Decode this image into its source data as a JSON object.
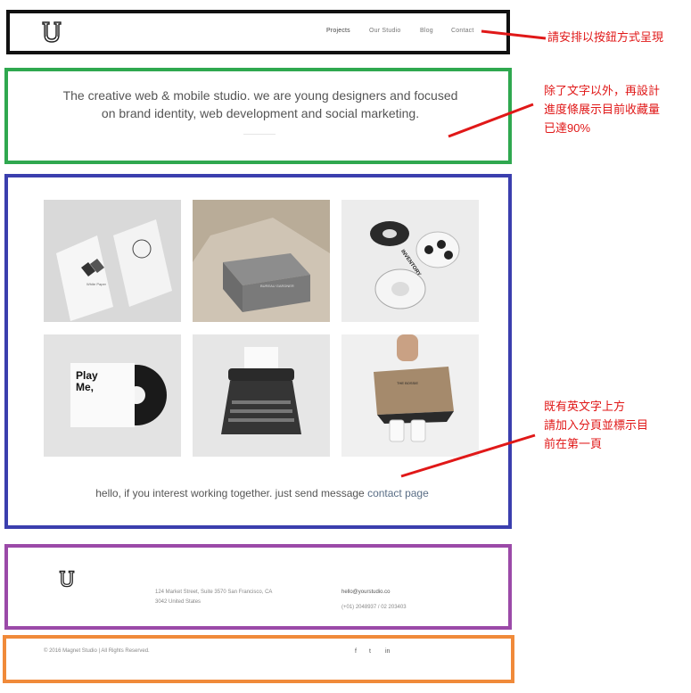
{
  "header": {
    "logo_letter": "U",
    "nav": [
      "Projects",
      "Our Studio",
      "Blog",
      "Contact"
    ]
  },
  "hero": {
    "line1": "The creative web & mobile studio. we are young designers and focused",
    "line2": "on brand identity, web development and social marketing."
  },
  "gallery": {
    "tiles": [
      {
        "label": "White Paper"
      },
      {
        "label": "BUREAU GARDNER"
      },
      {
        "label": "INVENTORY"
      },
      {
        "label": "Play Me,"
      },
      {
        "label": ""
      },
      {
        "label": "THE BOSSIE"
      }
    ],
    "caption_text": "hello, if you interest working together. just send message",
    "caption_link": "contact page"
  },
  "footer": {
    "address_line1": "124 Market Street, Suite 3570 San Francisco, CA",
    "address_line2": "3042 United States",
    "email": "hello@yourstudio.co",
    "phone": "(+01) 2048937 / 02 203403"
  },
  "bottom": {
    "copyright": "© 2016 Magnet Studio | All Rights Reserved.",
    "social": [
      "f",
      "t",
      "in"
    ]
  },
  "annotations": {
    "note_header": "請安排以按鈕方式呈現",
    "note_hero": [
      "除了文字以外，再設計",
      "進度條展示目前收藏量",
      "已達90%"
    ],
    "note_gallery": [
      "既有英文字上方",
      "請加入分頁並標示目",
      "前在第一頁"
    ]
  },
  "colors": {
    "header_frame": "#111111",
    "hero_frame": "#2fa84f",
    "gallery_frame": "#3b3fae",
    "footer_frame": "#9b4aa8",
    "bottom_frame": "#f08a3a",
    "annotation": "#e01818"
  }
}
